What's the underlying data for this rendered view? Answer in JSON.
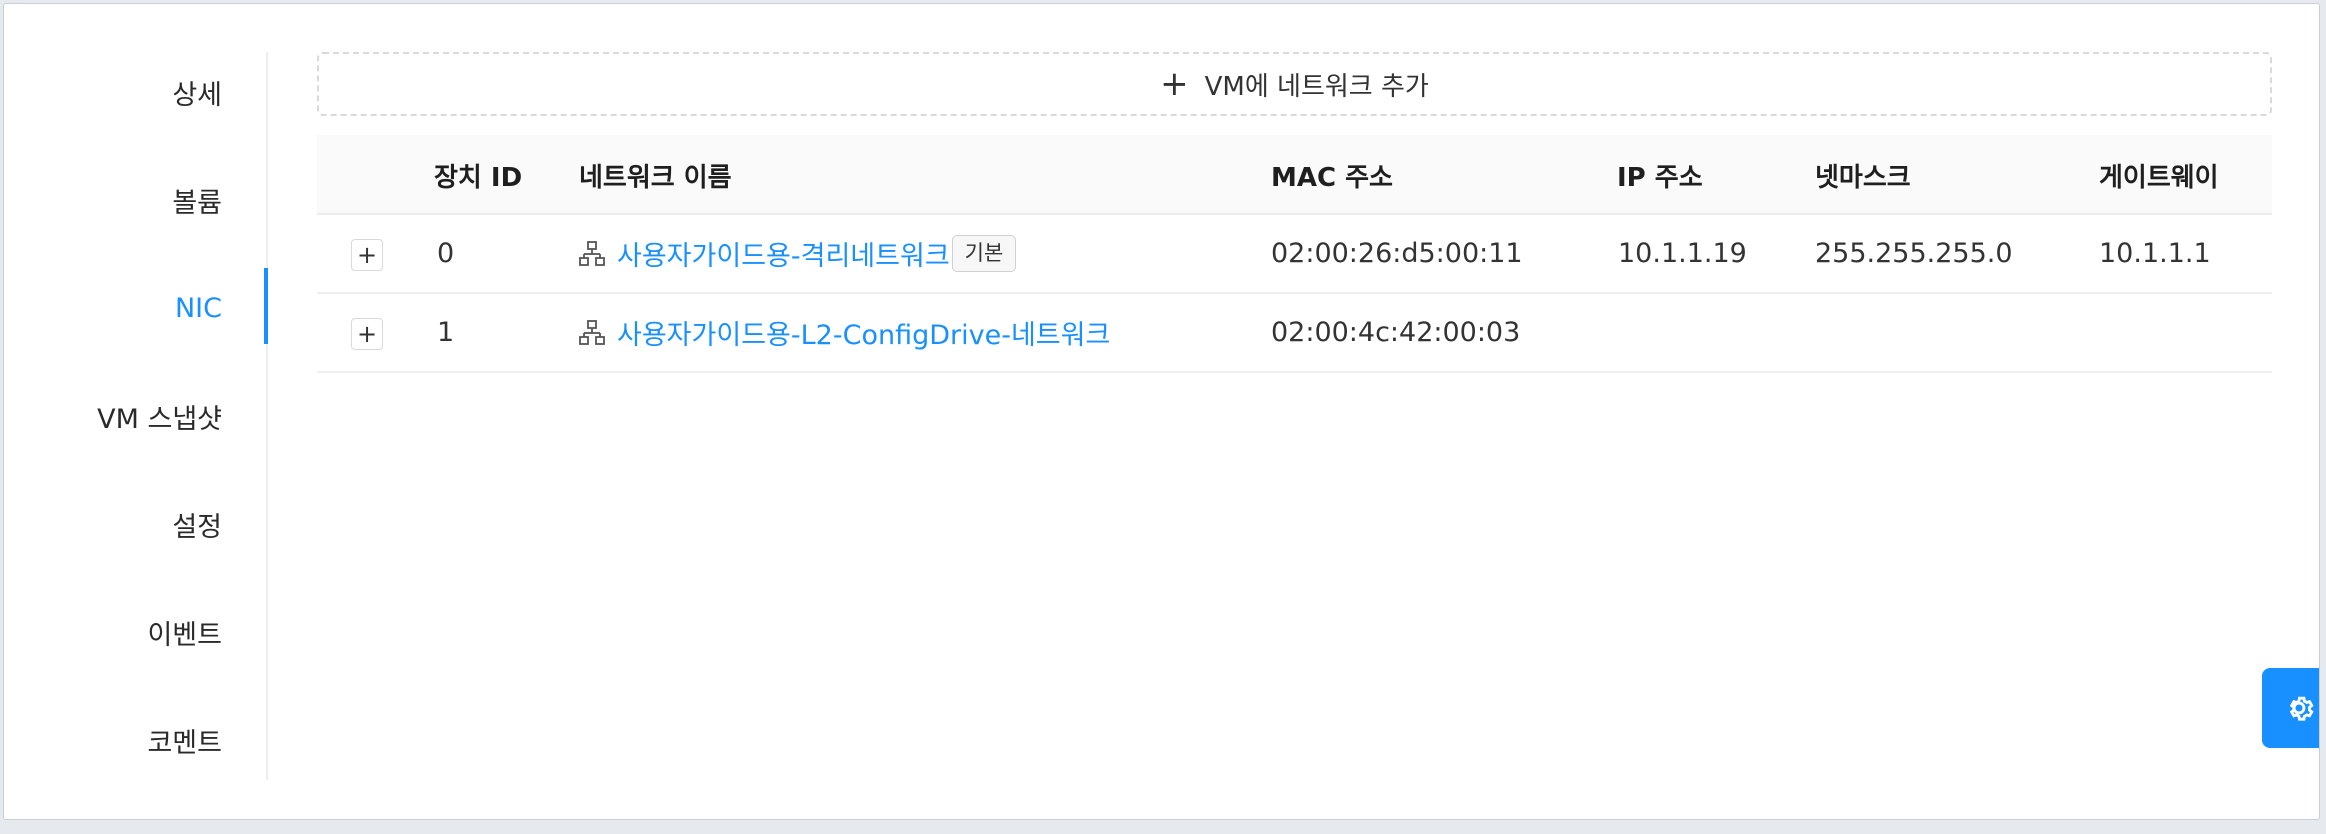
{
  "side_nav": {
    "items": [
      {
        "label": "상세",
        "active": false
      },
      {
        "label": "볼륨",
        "active": false
      },
      {
        "label": "NIC",
        "active": true
      },
      {
        "label": "VM 스냅샷",
        "active": false
      },
      {
        "label": "설정",
        "active": false
      },
      {
        "label": "이벤트",
        "active": false
      },
      {
        "label": "코멘트",
        "active": false
      }
    ]
  },
  "add_network": {
    "icon": "plus-icon",
    "label": "VM에 네트워크 추가"
  },
  "table": {
    "columns": [
      "장치 ID",
      "네트워크 이름",
      "MAC 주소",
      "IP 주소",
      "넷마스크",
      "게이트웨이"
    ],
    "rows": [
      {
        "expand": "+",
        "device_id": "0",
        "network_name": "사용자가이드용-격리네트워크",
        "tag": "기본",
        "mac": "02:00:26:d5:00:11",
        "ip": "10.1.1.19",
        "netmask": "255.255.255.0",
        "gateway": "10.1.1.1"
      },
      {
        "expand": "+",
        "device_id": "1",
        "network_name": "사용자가이드용-L2-ConfigDrive-네트워크",
        "tag": "",
        "mac": "02:00:4c:42:00:03",
        "ip": "",
        "netmask": "",
        "gateway": ""
      }
    ]
  },
  "colors": {
    "accent": "#1890ff",
    "header_bg": "#fafafa"
  },
  "settings_button": {
    "icon": "gear-icon"
  }
}
